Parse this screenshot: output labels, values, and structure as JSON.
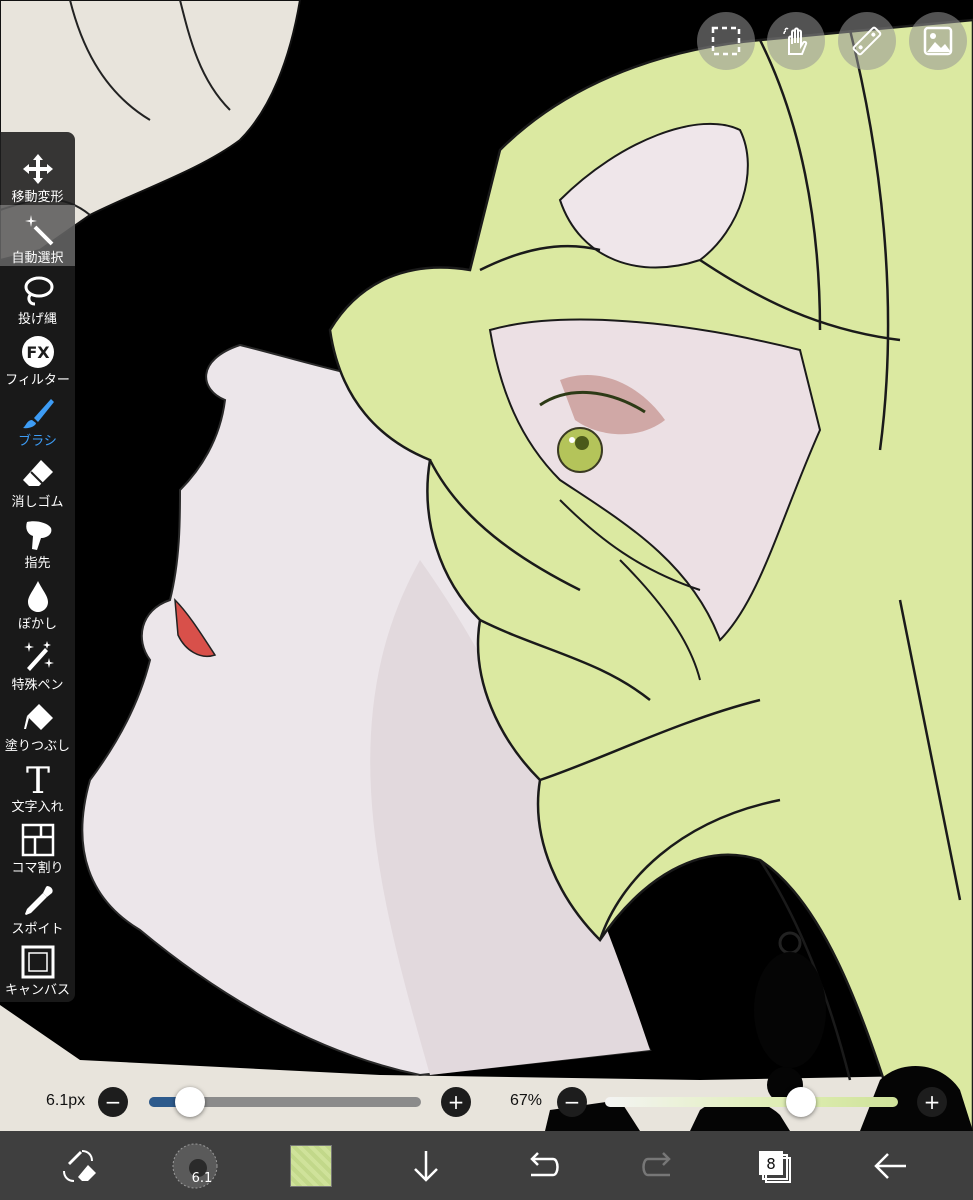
{
  "toolbar": {
    "items": [
      {
        "label": "移動変形",
        "icon": "move-icon"
      },
      {
        "label": "自動選択",
        "icon": "magic-wand-icon"
      },
      {
        "label": "投げ縄",
        "icon": "lasso-icon"
      },
      {
        "label": "フィルター",
        "icon": "fx-icon",
        "icon_text": "FX"
      },
      {
        "label": "ブラシ",
        "icon": "brush-icon"
      },
      {
        "label": "消しゴム",
        "icon": "eraser-icon"
      },
      {
        "label": "指先",
        "icon": "finger-icon"
      },
      {
        "label": "ぼかし",
        "icon": "drop-icon"
      },
      {
        "label": "特殊ペン",
        "icon": "sparkle-pen-icon"
      },
      {
        "label": "塗りつぶし",
        "icon": "bucket-icon"
      },
      {
        "label": "文字入れ",
        "icon": "text-icon",
        "icon_text": "T"
      },
      {
        "label": "コマ割り",
        "icon": "frame-divider-icon"
      },
      {
        "label": "スポイト",
        "icon": "eyedropper-icon"
      },
      {
        "label": "キャンバス",
        "icon": "canvas-icon"
      }
    ],
    "selected": "ブラシ"
  },
  "top_tools": [
    {
      "name": "selection-icon"
    },
    {
      "name": "hand-icon"
    },
    {
      "name": "ruler-icon"
    },
    {
      "name": "material-icon"
    }
  ],
  "brush_size": {
    "label": "6.1px",
    "value": 6.1,
    "fraction": 0.15
  },
  "opacity": {
    "label": "67%",
    "value": 67,
    "fraction": 0.67
  },
  "bottom_bar": {
    "brush_indicator": "6.1",
    "layer_count": "8",
    "current_color": "#cfe29a"
  },
  "colors": {
    "accent": "#3d9cf5",
    "hair": "#dbe9a1",
    "background": "#000000",
    "skin": "#ece7ea",
    "eye": "#b7c75a"
  }
}
